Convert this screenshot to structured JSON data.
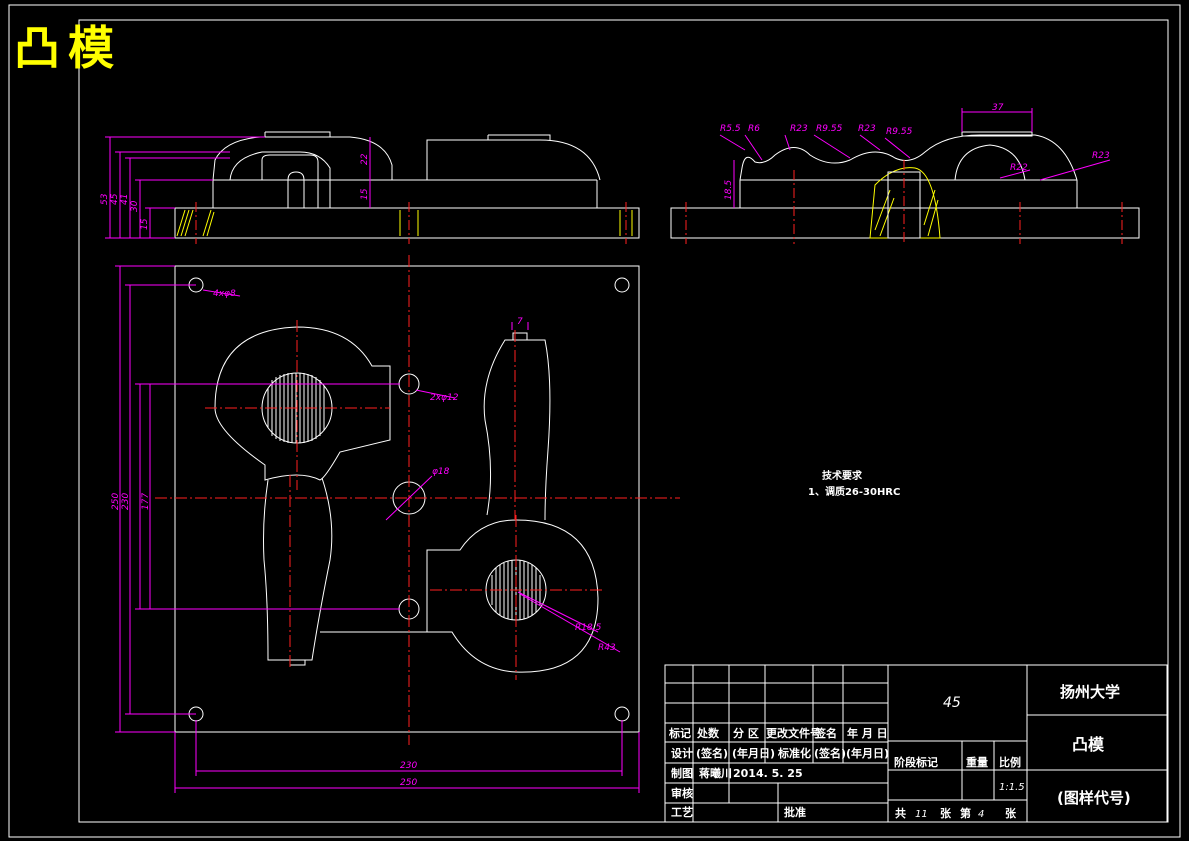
{
  "drawing_title": "凸模",
  "dimensions": {
    "front_left": [
      "53",
      "45",
      "41",
      "30",
      "15",
      "22",
      "15"
    ],
    "front_right": [
      "18.5",
      "R5.5",
      "R6",
      "R23",
      "R9.55",
      "R23",
      "R9.55",
      "37",
      "R23",
      "R22"
    ],
    "plan": [
      "4xφ8",
      "7",
      "2xφ12",
      "φ18",
      "R18.5",
      "R43",
      "250",
      "230",
      "177",
      "230",
      "250"
    ]
  },
  "tech_requirements": {
    "title": "技术要求",
    "item1": "1、调质26-30HRC"
  },
  "title_block": {
    "material": "45",
    "school": "扬州大学",
    "part_name": "凸模",
    "drawing_code": "(图样代号)",
    "rev_headers": [
      "标记",
      "处数",
      "分 区",
      "更改文件号",
      "签名",
      "年 月 日"
    ],
    "row_design": [
      "设计",
      "(签名)",
      "(年月日)",
      "标准化",
      "(签名)",
      "(年月日)"
    ],
    "row_draw_label": "制图",
    "drawer": "蒋曦川",
    "draw_date": "2014. 5. 25",
    "row_check": "审核",
    "row_process": "工艺",
    "approve": "批准",
    "stage_mark": "阶段标记",
    "weight": "重量",
    "scale_label": "比例",
    "scale": "1:1.5",
    "sheets_total_label": "共",
    "sheets_total": "11",
    "sheets_unit": "张",
    "sheet_no_label": "第",
    "sheet_no": "4",
    "sheet_unit": "张"
  }
}
